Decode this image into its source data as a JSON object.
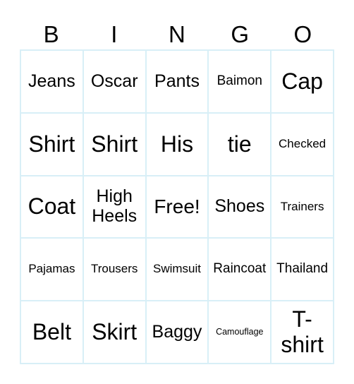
{
  "header": {
    "letters": [
      "B",
      "I",
      "N",
      "G",
      "O"
    ]
  },
  "colors": {
    "grid_border": "#d8eff7",
    "text": "#000000",
    "background": "#ffffff"
  },
  "cells": [
    [
      "Jeans",
      "Oscar",
      "Pants",
      "Baimon",
      "Cap"
    ],
    [
      "Shirt",
      "Shirt",
      "His",
      "tie",
      "Checked"
    ],
    [
      "Coat",
      "High Heels",
      "Free!",
      "Shoes",
      "Trainers"
    ],
    [
      "Pajamas",
      "Trousers",
      "Swimsuit",
      "Raincoat",
      "Thailand"
    ],
    [
      "Belt",
      "Skirt",
      "Baggy",
      "Camouflage",
      "T-shirt"
    ]
  ]
}
